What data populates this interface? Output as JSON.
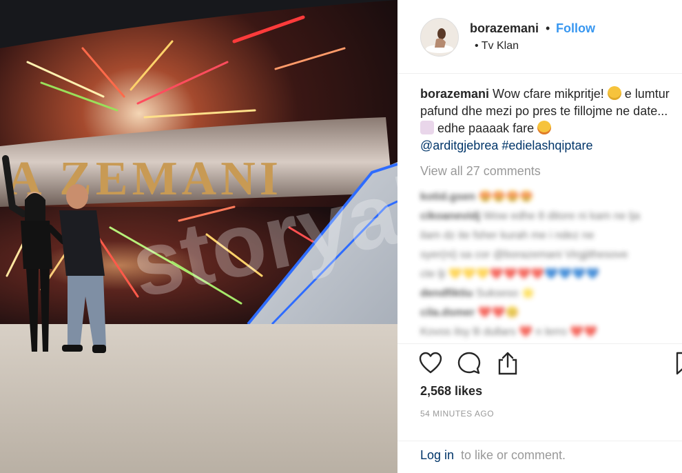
{
  "post": {
    "username": "borazemani",
    "follow_label": "Follow",
    "location_dot": "•",
    "location": "Tv Klan",
    "header_dot": "•"
  },
  "photo": {
    "banner_text": "A ZEMANI",
    "watermark": "storyal"
  },
  "caption": {
    "username": "borazemani",
    "text_1": "Wow cfare mikpritje!",
    "text_2": "e lumtur pafund dhe mezi po pres te fillojme ne date...",
    "text_3": "edhe paaaak fare",
    "tag_user": "@arditgjebrea",
    "tag_hash": "#edielashqiptare"
  },
  "comments": {
    "view_all": "View all 27 comments",
    "blurred": [
      {
        "user": "kotid.gsen",
        "text": "😍😍😍😍"
      },
      {
        "user": "cikoanevidj",
        "text": "Wow edhe 8 ditore ni kam ne lja"
      },
      {
        "user": "",
        "text": "ilam dz ite fsher kurah me i ndez ne"
      },
      {
        "user": "",
        "text": "syer(ni) sa cor @borazemani Virgjithesove"
      },
      {
        "user": "",
        "text": "cte lji 💛💛💛❤️❤️❤️❤️💙💙💙💙"
      },
      {
        "user": "dendfiktiu",
        "text": "Sukseso 🌟"
      },
      {
        "user": "cila.dsmer",
        "text": "❤️❤️😊"
      },
      {
        "user": "",
        "text": "Kovos ilsy lli dullars ❤️ n lerro ❤️❤️"
      }
    ]
  },
  "actions": {
    "likes": "2,568 likes",
    "time": "54 MINUTES AGO"
  },
  "login": {
    "link": "Log in",
    "rest": "to like or comment."
  },
  "colors": {
    "link_blue": "#3897f0",
    "tag_navy": "#003569",
    "muted": "#999999"
  }
}
